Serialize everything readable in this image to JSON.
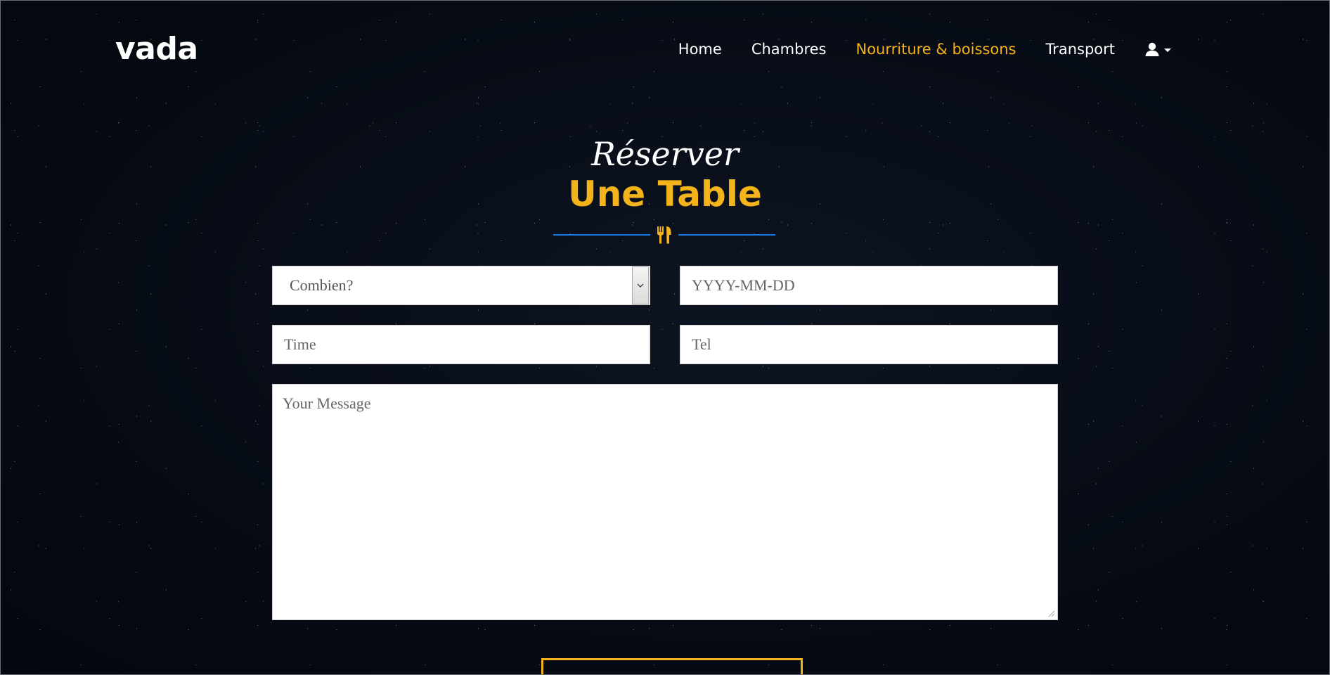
{
  "brand": {
    "logo": "vada"
  },
  "nav": {
    "items": [
      {
        "label": "Home"
      },
      {
        "label": "Chambres"
      },
      {
        "label": "Nourriture & boissons",
        "active": true
      },
      {
        "label": "Transport"
      }
    ],
    "user_icon": "user-icon"
  },
  "heading": {
    "subtitle": "Réserver",
    "title": "Une Table",
    "divider_icon": "utensils-icon"
  },
  "form": {
    "guests_select": {
      "value": "Combien?"
    },
    "date": {
      "placeholder": "YYYY-MM-DD"
    },
    "time": {
      "placeholder": "Time"
    },
    "tel": {
      "placeholder": "Tel"
    },
    "message": {
      "placeholder": "Your Message"
    }
  },
  "colors": {
    "accent": "#f5b31b",
    "divider_blue": "#1a7be6",
    "background": "#050a13"
  }
}
